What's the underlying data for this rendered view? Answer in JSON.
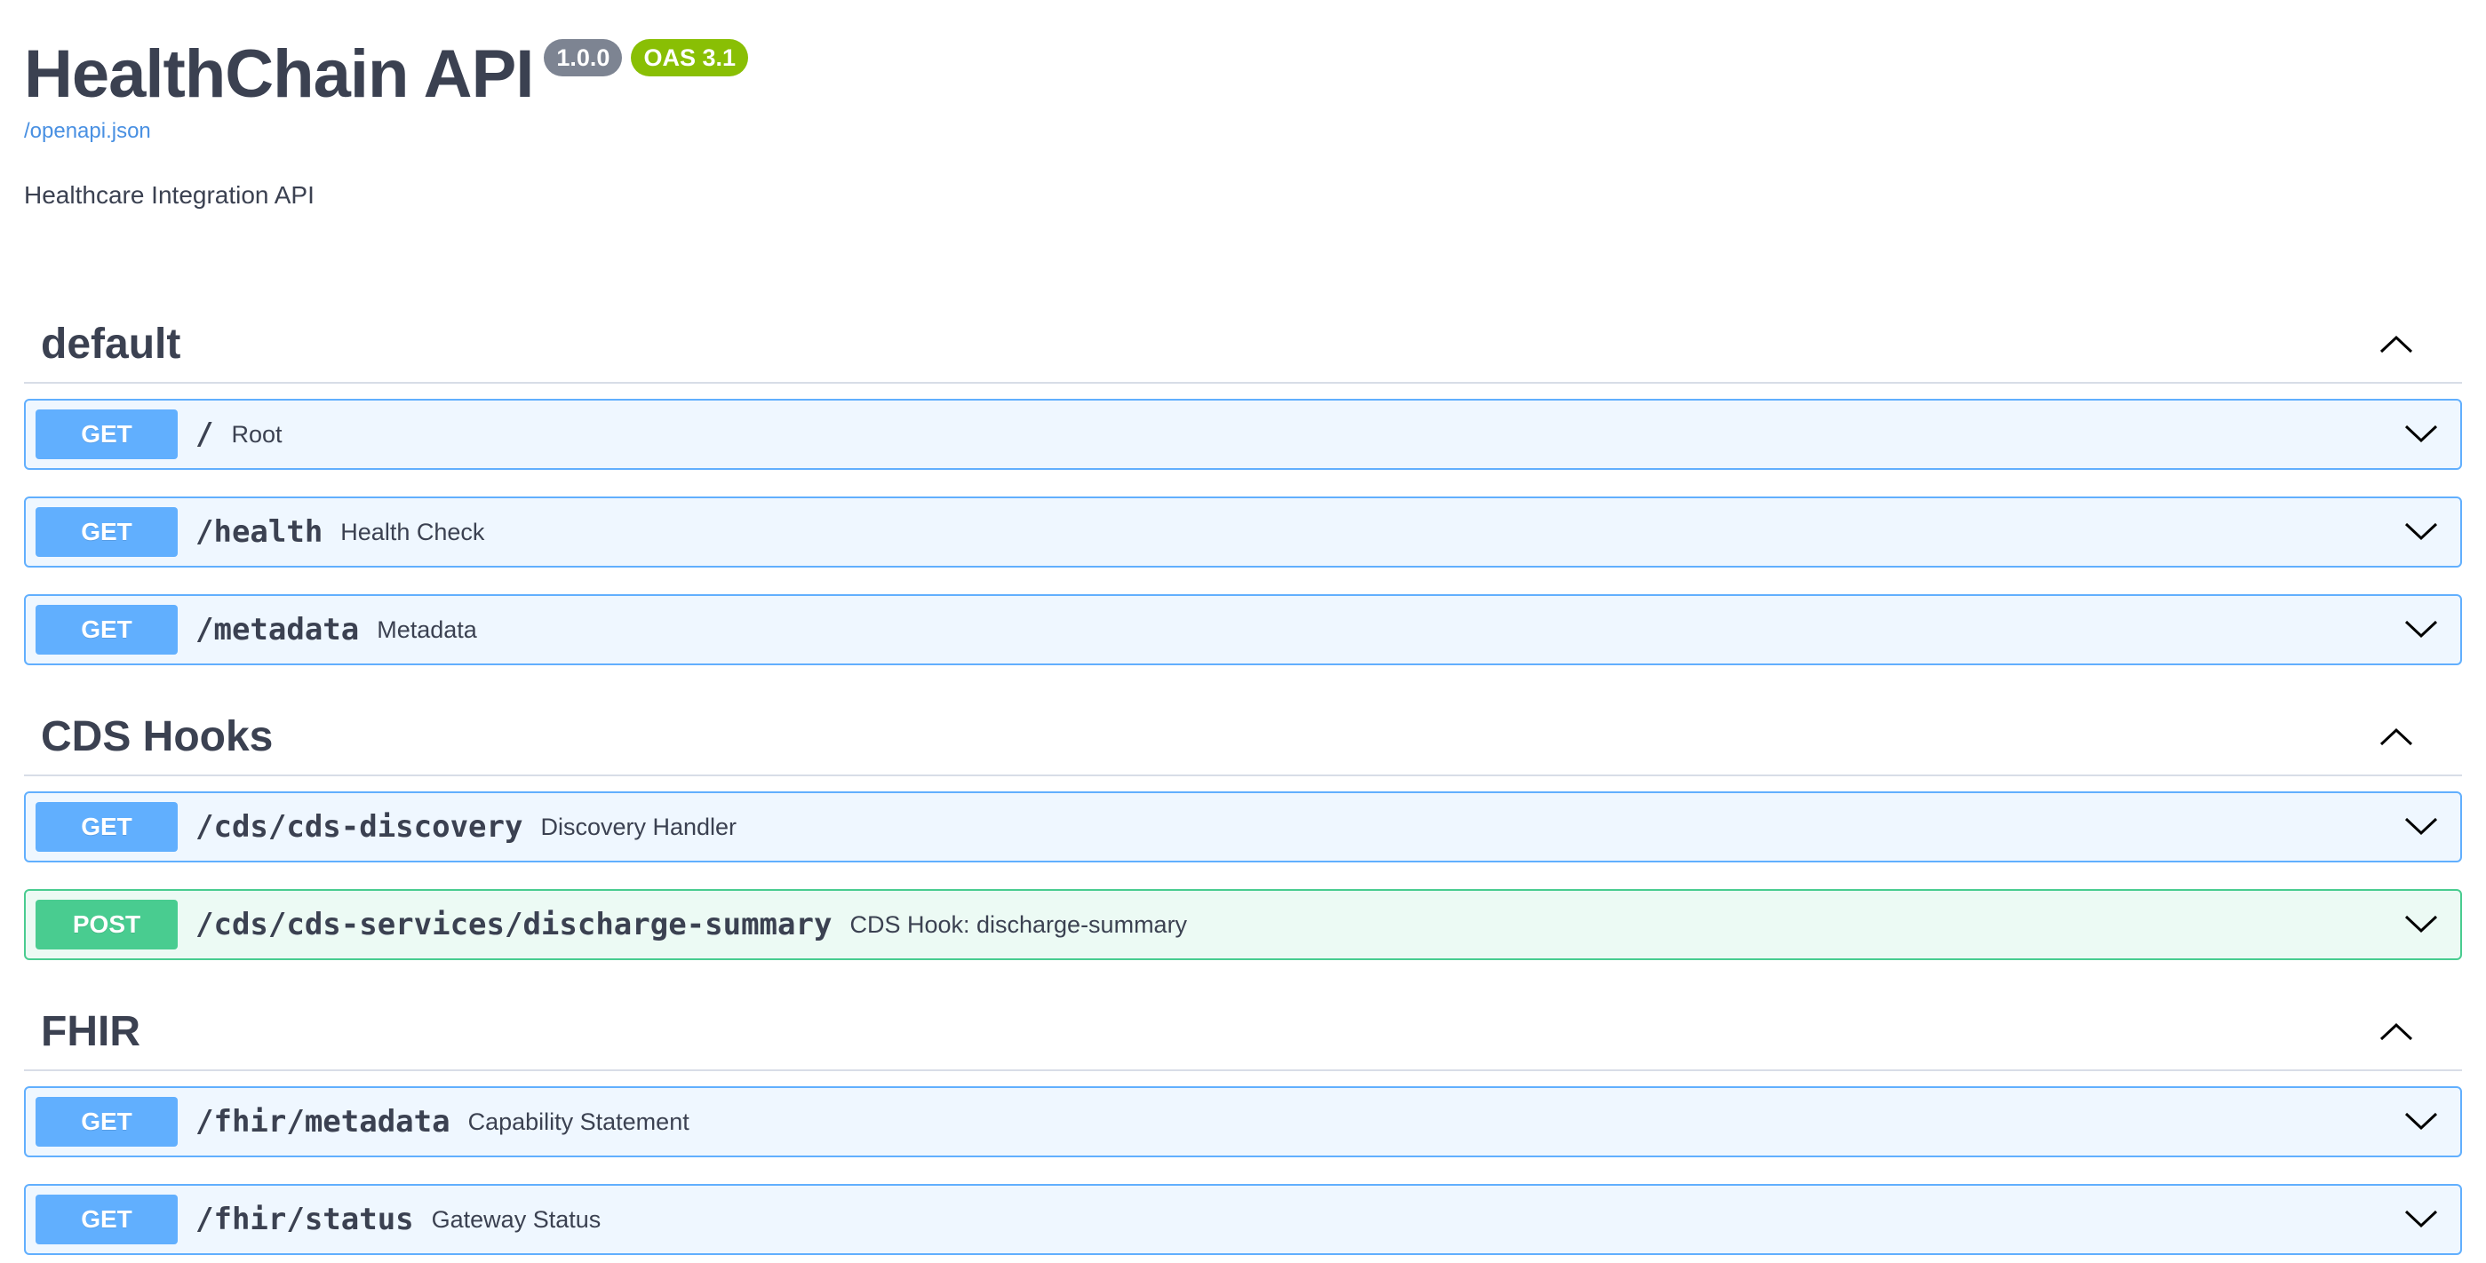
{
  "info": {
    "title": "HealthChain API",
    "version": "1.0.0",
    "oas": "OAS 3.1",
    "spec_link": "/openapi.json",
    "description": "Healthcare Integration API"
  },
  "tags": [
    {
      "name": "default",
      "operations": [
        {
          "method": "GET",
          "path": "/",
          "summary": "Root"
        },
        {
          "method": "GET",
          "path": "/health",
          "summary": "Health Check"
        },
        {
          "method": "GET",
          "path": "/metadata",
          "summary": "Metadata"
        }
      ]
    },
    {
      "name": "CDS Hooks",
      "operations": [
        {
          "method": "GET",
          "path": "/cds/cds-discovery",
          "summary": "Discovery Handler"
        },
        {
          "method": "POST",
          "path": "/cds/cds-services/discharge-summary",
          "summary": "CDS Hook: discharge-summary"
        }
      ]
    },
    {
      "name": "FHIR",
      "operations": [
        {
          "method": "GET",
          "path": "/fhir/metadata",
          "summary": "Capability Statement"
        },
        {
          "method": "GET",
          "path": "/fhir/status",
          "summary": "Gateway Status"
        }
      ]
    }
  ],
  "icons": {
    "tag_arrow": "chevron-up-icon",
    "op_arrow": "chevron-down-icon"
  },
  "colors": {
    "get": "#61affe",
    "post": "#49cc90",
    "version_badge": "#7d8492",
    "oas_badge": "#89bf04",
    "link": "#4990e2"
  }
}
